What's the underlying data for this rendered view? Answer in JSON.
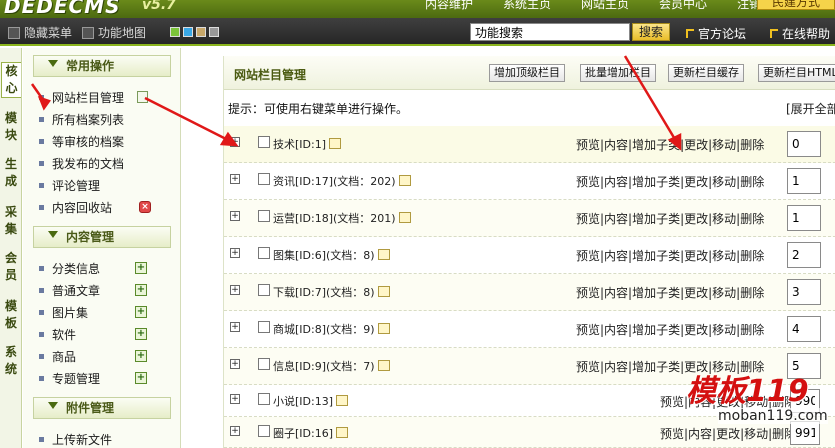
{
  "header": {
    "logo": "DEDECMS",
    "version": "v5.7",
    "nav": [
      "内容维护",
      "系统主页",
      "网站主页",
      "会员中心",
      "注销"
    ],
    "highlight_button": "民建方式"
  },
  "toolbar": {
    "hide_menu": "隐藏菜单",
    "site_map": "功能地图",
    "swatch_colors": [
      "#7cc43a",
      "#3aa8e6",
      "#c8a86a",
      "#999999"
    ],
    "search_value": "功能搜索",
    "search_button": "搜索",
    "forum": "官方论坛",
    "help": "在线帮助"
  },
  "vtabs": [
    "核心",
    "模块",
    "生成",
    "采集",
    "会员",
    "模板",
    "系统"
  ],
  "sidebar": {
    "sections": [
      {
        "title": "常用操作",
        "items": [
          "网站栏目管理",
          "所有档案列表",
          "等审核的档案",
          "我发布的文档",
          "评论管理",
          "内容回收站"
        ]
      },
      {
        "title": "内容管理",
        "items": [
          "分类信息",
          "普通文章",
          "图片集",
          "软件",
          "商品",
          "专题管理"
        ]
      },
      {
        "title": "附件管理",
        "items": [
          "上传新文件"
        ]
      }
    ]
  },
  "main": {
    "title": "网站栏目管理",
    "buttons": [
      "增加顶级栏目",
      "批量增加栏目",
      "更新栏目缓存",
      "更新栏目HTML"
    ],
    "tip": "提示：可使用右键菜单进行操作。",
    "expand_all": "[展开全部",
    "rows": [
      {
        "name": "技术[ID:1]",
        "ops": "预览|内容|增加子类|更改|移动|删除",
        "order": "0"
      },
      {
        "name": "资讯[ID:17](文档：202)",
        "ops": "预览|内容|增加子类|更改|移动|删除",
        "order": "1"
      },
      {
        "name": "运营[ID:18](文档：201)",
        "ops": "预览|内容|增加子类|更改|移动|删除",
        "order": "1"
      },
      {
        "name": "图集[ID:6](文档：8)",
        "ops": "预览|内容|增加子类|更改|移动|删除",
        "order": "2"
      },
      {
        "name": "下载[ID:7](文档：8)",
        "ops": "预览|内容|增加子类|更改|移动|删除",
        "order": "3"
      },
      {
        "name": "商城[ID:8](文档：9)",
        "ops": "预览|内容|增加子类|更改|移动|删除",
        "order": "4"
      },
      {
        "name": "信息[ID:9](文档：7)",
        "ops": "预览|内容|增加子类|更改|移动|删除",
        "order": "5"
      },
      {
        "name": "小说[ID:13]",
        "ops": "预览|内容|更改|移动|删除",
        "order": "990"
      },
      {
        "name": "圈子[ID:16]",
        "ops": "预览|内容|更改|移动|删除",
        "order": "991"
      }
    ]
  },
  "watermark": {
    "logo": "模板119",
    "url": "moban119.com"
  },
  "colors": {
    "accent_green": "#8bb51e",
    "arrow_red": "#e01818"
  }
}
